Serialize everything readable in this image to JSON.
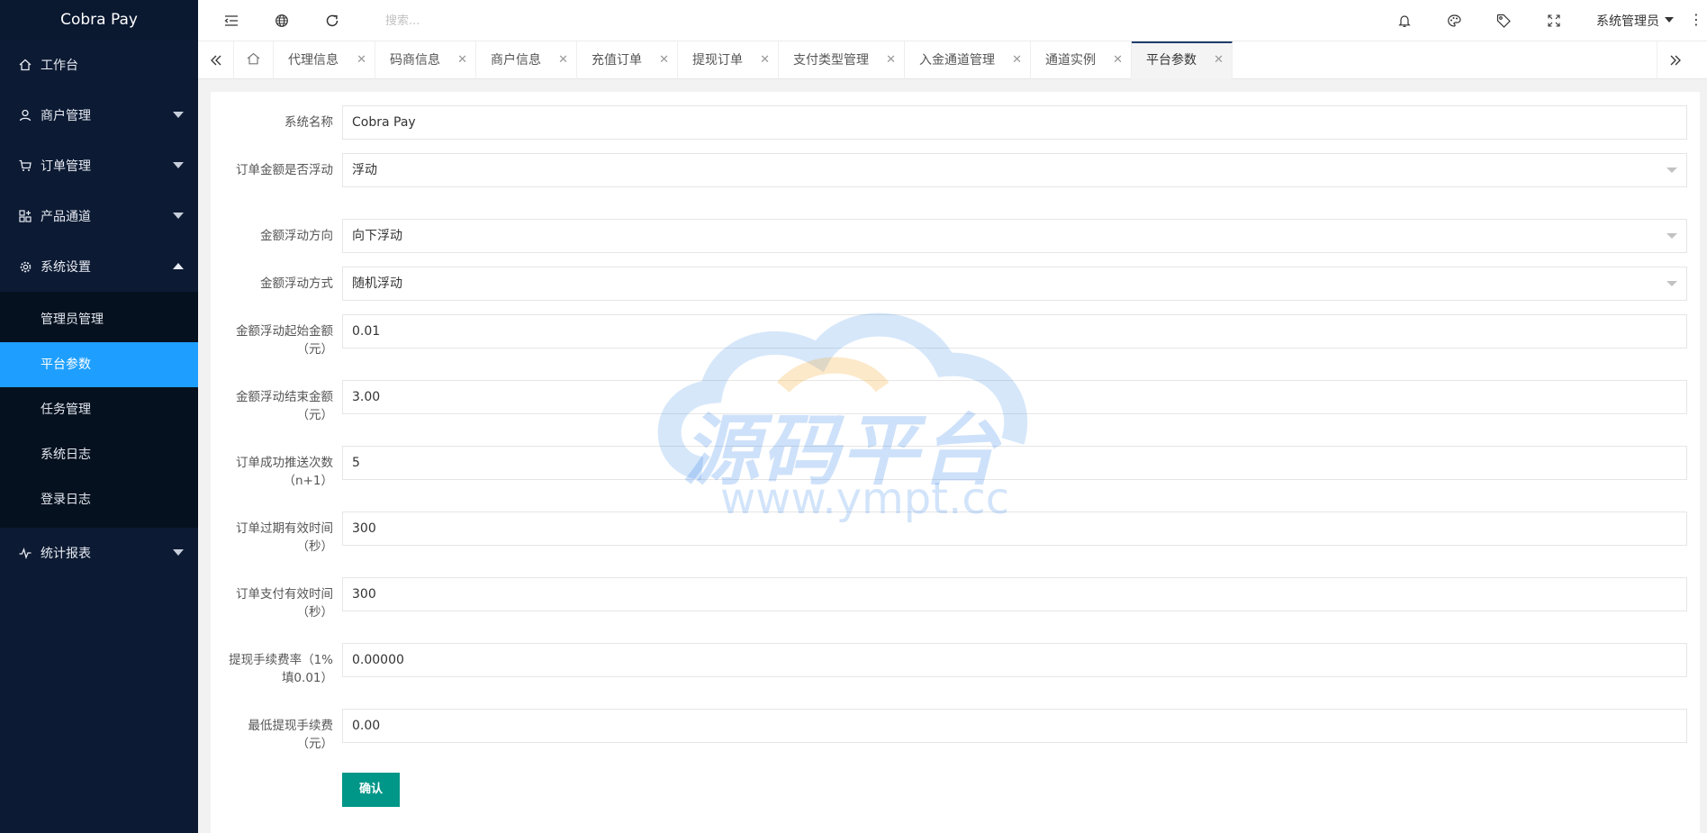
{
  "app": {
    "name": "Cobra Pay"
  },
  "sidebar": {
    "items": [
      {
        "label": "工作台",
        "icon": "home-icon"
      },
      {
        "label": "商户管理",
        "icon": "user-icon",
        "expandable": true
      },
      {
        "label": "订单管理",
        "icon": "cart-icon",
        "expandable": true
      },
      {
        "label": "产品通道",
        "icon": "apps-icon",
        "expandable": true
      },
      {
        "label": "系统设置",
        "icon": "gear-icon",
        "expandable": true,
        "expanded": true
      },
      {
        "label": "统计报表",
        "icon": "chart-icon",
        "expandable": true
      }
    ],
    "sub_items": [
      {
        "label": "管理员管理"
      },
      {
        "label": "平台参数",
        "active": true
      },
      {
        "label": "任务管理"
      },
      {
        "label": "系统日志"
      },
      {
        "label": "登录日志"
      }
    ],
    "active_color": "#1e9fff",
    "bg_color": "#0c1a33"
  },
  "header": {
    "search_placeholder": "搜索...",
    "admin_name": "系统管理员",
    "icons": [
      "menu-fold-icon",
      "globe-icon",
      "refresh-icon",
      "bell-icon",
      "palette-icon",
      "tag-icon",
      "fullscreen-icon"
    ]
  },
  "tabs": [
    {
      "label": "代理信息"
    },
    {
      "label": "码商信息"
    },
    {
      "label": "商户信息"
    },
    {
      "label": "充值订单"
    },
    {
      "label": "提现订单"
    },
    {
      "label": "支付类型管理"
    },
    {
      "label": "入金通道管理"
    },
    {
      "label": "通道实例"
    },
    {
      "label": "平台参数",
      "active": true
    }
  ],
  "form": {
    "fields": [
      {
        "label": "系统名称",
        "value": "Cobra Pay",
        "type": "text"
      },
      {
        "label": "订单金额是否浮动",
        "value": "浮动",
        "type": "select"
      },
      {
        "label": "金额浮动方向",
        "value": "向下浮动",
        "type": "select"
      },
      {
        "label": "金额浮动方式",
        "value": "随机浮动",
        "type": "select"
      },
      {
        "label": "金额浮动起始金额（元）",
        "value": "0.01",
        "type": "text"
      },
      {
        "label": "金额浮动结束金额（元）",
        "value": "3.00",
        "type": "text"
      },
      {
        "label": "订单成功推送次数（n+1）",
        "value": "5",
        "type": "text"
      },
      {
        "label": "订单过期有效时间（秒）",
        "value": "300",
        "type": "text"
      },
      {
        "label": "订单支付有效时间（秒）",
        "value": "300",
        "type": "text"
      },
      {
        "label": "提现手续费率（1%填0.01）",
        "value": "0.00000",
        "type": "text"
      },
      {
        "label": "最低提现手续费（元）",
        "value": "0.00",
        "type": "text"
      }
    ],
    "submit_label": "确认",
    "submit_color": "#009688"
  },
  "watermark": {
    "title": "源码平台",
    "url": "www.ympt.cc"
  }
}
